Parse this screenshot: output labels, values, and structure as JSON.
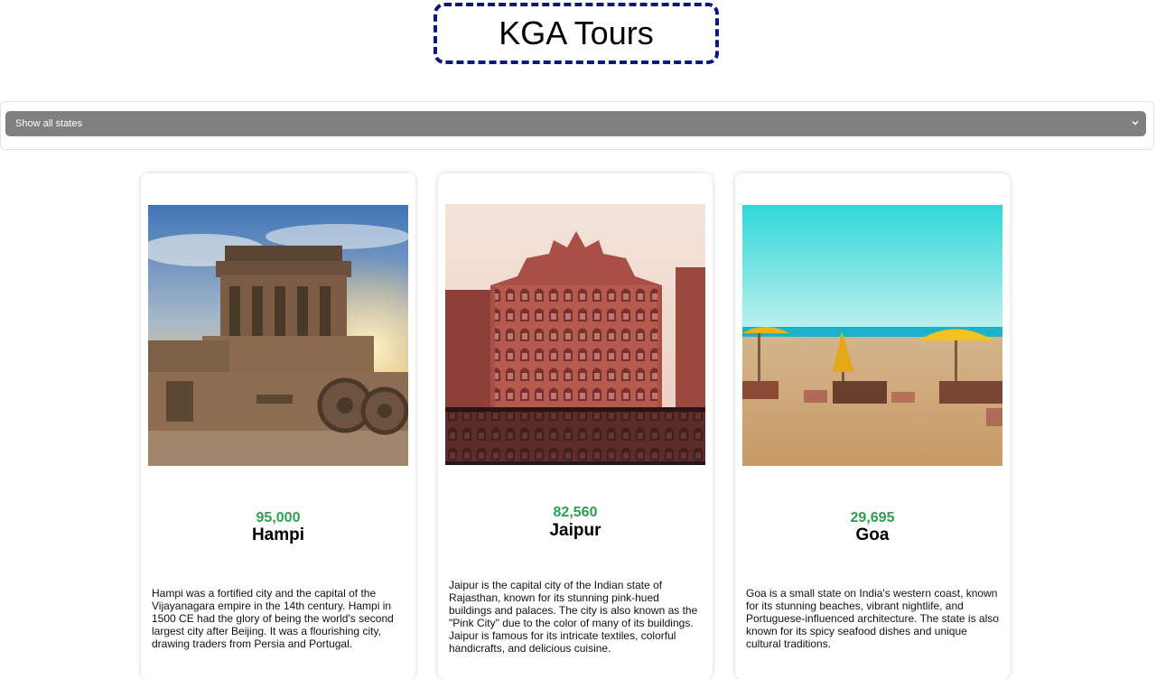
{
  "header": {
    "title": "KGA Tours",
    "accent_color": "#0b1a7a"
  },
  "filter": {
    "selected": "Show all states",
    "icon": "chevron-down-icon"
  },
  "price_color": "#2e9e52",
  "cards": [
    {
      "price": "95,000",
      "name": "Hampi",
      "image": "hampi-stone-chariot-image",
      "description": "Hampi was a fortified city and the capital of the Vijayanagara empire in the 14th century. Hampi in 1500 CE had the glory of being the world's second largest city after Beijing. It was a flourishing city, drawing traders from Persia and Portugal."
    },
    {
      "price": "82,560",
      "name": "Jaipur",
      "image": "hawa-mahal-image",
      "description": "Jaipur is the capital city of the Indian state of Rajasthan, known for its stunning pink-hued buildings and palaces. The city is also known as the \"Pink City\" due to the color of many of its buildings. Jaipur is famous for its intricate textiles, colorful handicrafts, and delicious cuisine."
    },
    {
      "price": "29,695",
      "name": "Goa",
      "image": "goa-beach-image",
      "description": "Goa is a small state on India's western coast, known for its stunning beaches, vibrant nightlife, and Portuguese-influenced architecture. The state is also known for its spicy seafood dishes and unique cultural traditions."
    }
  ]
}
